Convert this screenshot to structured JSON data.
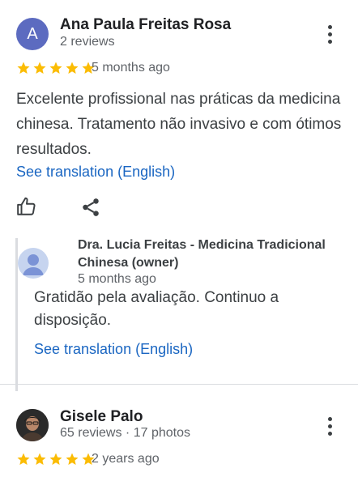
{
  "reviews": [
    {
      "author": "Ana Paula Freitas Rosa",
      "avatar_letter": "A",
      "meta": "2 reviews",
      "rating": 5,
      "date": "5 months ago",
      "text": "Excelente profissional nas práticas da medicina chinesa. Tratamento não invasivo e com ótimos resultados.",
      "translate_label": "See translation (English)",
      "reply": {
        "owner": "Dra. Lucia Freitas - Medicina Tradicional Chinesa (owner)",
        "date": "5 months ago",
        "text": "Gratidão pela avaliação. Continuo a disposição.",
        "translate_label": "See translation (English)"
      }
    },
    {
      "author": "Gisele Palo",
      "meta": "65 reviews · 17 photos",
      "rating": 5,
      "date": "2 years ago"
    }
  ],
  "colors": {
    "star": "#fbbc04",
    "link": "#1a66c2",
    "avatar_bg": "#5c6bc0",
    "owner_avatar_bg": "#c6d4ef"
  },
  "icons": [
    "more-vert-icon",
    "star-icon",
    "thumb-up-icon",
    "share-icon",
    "person-icon"
  ]
}
